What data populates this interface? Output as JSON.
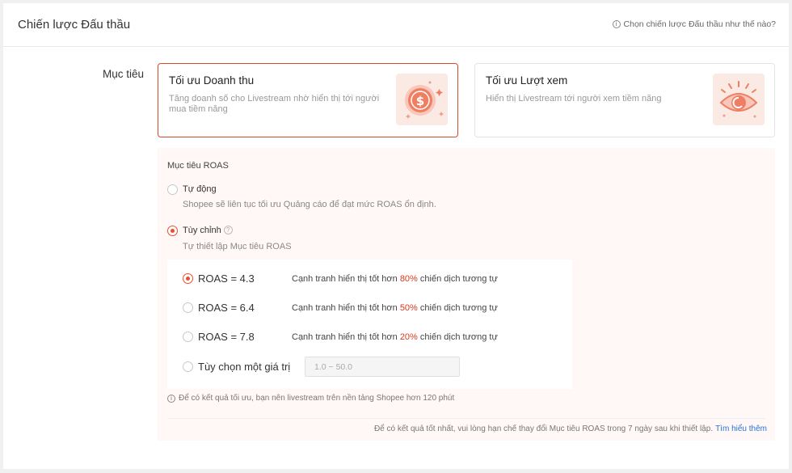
{
  "header": {
    "title": "Chiến lược Đấu thầu",
    "help_link": "Chọn chiến lược Đấu thầu như thế nào?"
  },
  "goal": {
    "label": "Mục tiêu",
    "options": [
      {
        "title": "Tối ưu Doanh thu",
        "description": "Tăng doanh số cho Livestream nhờ hiển thị tới người mua tiềm năng",
        "icon": "revenue-coin-icon",
        "selected": true
      },
      {
        "title": "Tối ưu Lượt xem",
        "description": "Hiển thị Livestream tới người xem tiềm năng",
        "icon": "views-eye-icon",
        "selected": false
      }
    ]
  },
  "roas": {
    "title": "Mục tiêu ROAS",
    "auto": {
      "label": "Tự động",
      "description": "Shopee sẽ liên tục tối ưu Quảng cáo để đạt mức ROAS ổn định.",
      "selected": false
    },
    "custom": {
      "label": "Tùy chỉnh",
      "description": "Tự thiết lập Mục tiêu ROAS",
      "selected": true
    },
    "choices": [
      {
        "label": "ROAS = 4.3",
        "desc_prefix": "Cạnh tranh hiển thị tốt hơn",
        "percent": "80%",
        "desc_suffix": "chiến dịch tương tự",
        "selected": true
      },
      {
        "label": "ROAS = 6.4",
        "desc_prefix": "Cạnh tranh hiển thị tốt hơn",
        "percent": "50%",
        "desc_suffix": "chiến dịch tương tự",
        "selected": false
      },
      {
        "label": "ROAS = 7.8",
        "desc_prefix": "Cạnh tranh hiển thị tốt hơn",
        "percent": "20%",
        "desc_suffix": "chiến dịch tương tự",
        "selected": false
      }
    ],
    "custom_value": {
      "label": "Tùy chọn một giá trị",
      "placeholder": "1.0 ~ 50.0",
      "value": ""
    },
    "tip": "Để có kết quả tối ưu, bạn nên livestream trên nền tảng Shopee hơn 120 phút",
    "footer_note": "Để có kết quả tốt nhất, vui lòng hạn chế thay đổi Mục tiêu ROAS trong 7 ngày sau khi thiết lập.",
    "learn_more": "Tìm hiểu thêm"
  },
  "colors": {
    "accent": "#ee4d2d",
    "selected_border": "#d74a2b",
    "percent_text": "#d73a1e",
    "link": "#2673dd",
    "panel_bg": "#fff8f6"
  }
}
